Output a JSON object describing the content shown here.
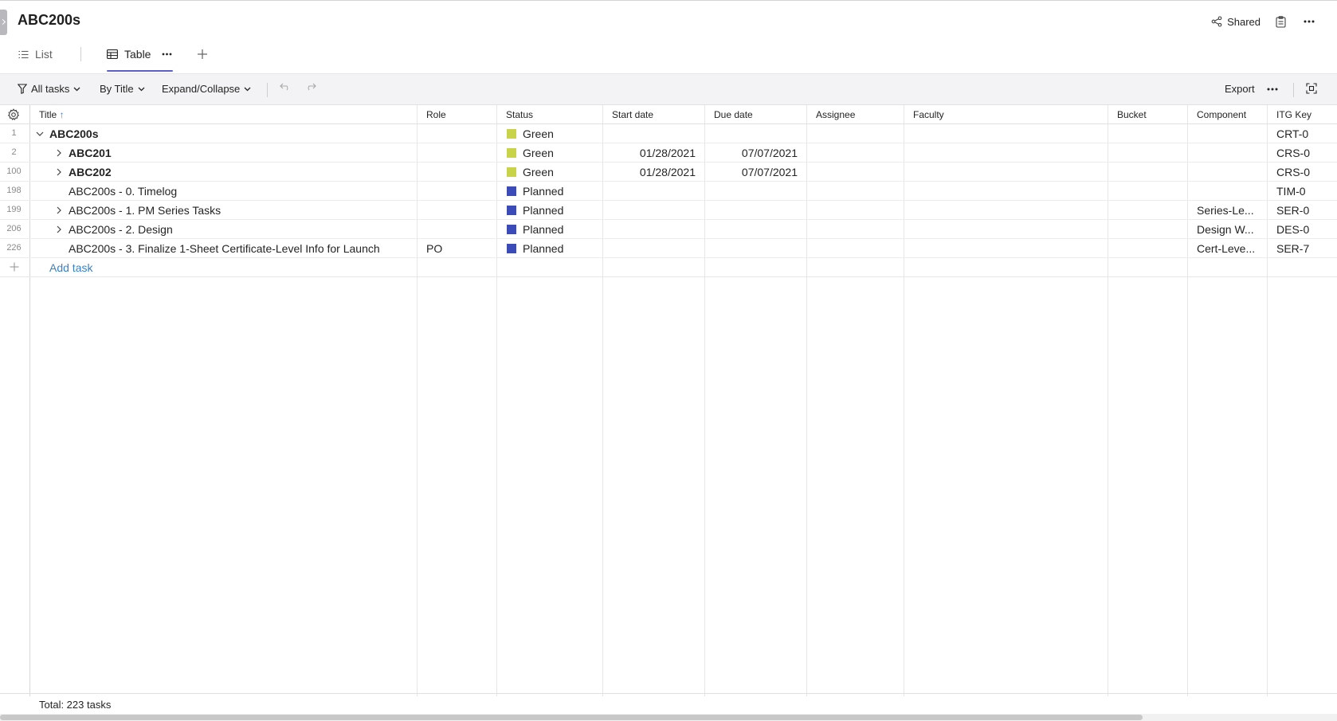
{
  "header": {
    "title": "ABC200s",
    "shared_label": "Shared"
  },
  "tabs": [
    {
      "label": "List"
    },
    {
      "label": "Table"
    }
  ],
  "toolbar": {
    "filter_label": "All tasks",
    "group_label": "By Title",
    "expand_label": "Expand/Collapse",
    "export_label": "Export"
  },
  "columns": {
    "title": "Title",
    "role": "Role",
    "status": "Status",
    "start": "Start date",
    "due": "Due date",
    "assignee": "Assignee",
    "faculty": "Faculty",
    "bucket": "Bucket",
    "component": "Component",
    "key": "ITG Key"
  },
  "rows": [
    {
      "num": "1",
      "title": "ABC200s",
      "role": "",
      "status": "Green",
      "start": "",
      "due": "",
      "component": "",
      "key": "CRT-0"
    },
    {
      "num": "2",
      "title": "ABC201",
      "role": "",
      "status": "Green",
      "start": "01/28/2021",
      "due": "07/07/2021",
      "component": "",
      "key": "CRS-0"
    },
    {
      "num": "100",
      "title": "ABC202",
      "role": "",
      "status": "Green",
      "start": "01/28/2021",
      "due": "07/07/2021",
      "component": "",
      "key": "CRS-0"
    },
    {
      "num": "198",
      "title": "ABC200s - 0. Timelog",
      "role": "",
      "status": "Planned",
      "start": "",
      "due": "",
      "component": "",
      "key": "TIM-0"
    },
    {
      "num": "199",
      "title": "ABC200s - 1. PM Series Tasks",
      "role": "",
      "status": "Planned",
      "start": "",
      "due": "",
      "component": "Series-Le...",
      "key": "SER-0"
    },
    {
      "num": "206",
      "title": "ABC200s - 2. Design",
      "role": "",
      "status": "Planned",
      "start": "",
      "due": "",
      "component": "Design W...",
      "key": "DES-0"
    },
    {
      "num": "226",
      "title": "ABC200s - 3. Finalize 1-Sheet Certificate-Level Info for Launch",
      "role": "PO",
      "status": "Planned",
      "start": "",
      "due": "",
      "component": "Cert-Leve...",
      "key": "SER-7"
    }
  ],
  "add_task_label": "Add task",
  "footer": {
    "total": "Total: 223 tasks"
  },
  "colors": {
    "green": "#c9d34a",
    "planned": "#3b4cb8",
    "accent": "#5b5fc7",
    "link": "#3b82c4"
  }
}
